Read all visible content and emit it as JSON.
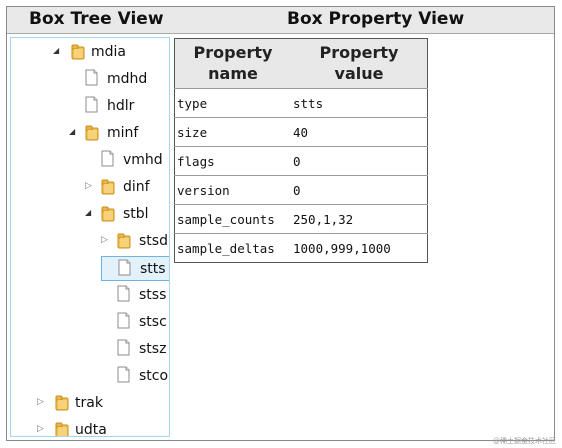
{
  "headers": {
    "tree": "Box Tree View",
    "property": "Box Property View"
  },
  "tree": [
    {
      "label": "mdia",
      "kind": "folder",
      "state": "expanded",
      "selected": false
    },
    {
      "label": "mdhd",
      "kind": "file",
      "state": "leaf",
      "selected": false
    },
    {
      "label": "hdlr",
      "kind": "file",
      "state": "leaf",
      "selected": false
    },
    {
      "label": "minf",
      "kind": "folder",
      "state": "expanded",
      "selected": false
    },
    {
      "label": "vmhd",
      "kind": "file",
      "state": "leaf",
      "selected": false
    },
    {
      "label": "dinf",
      "kind": "folder",
      "state": "collapsed",
      "selected": false
    },
    {
      "label": "stbl",
      "kind": "folder",
      "state": "expanded",
      "selected": false
    },
    {
      "label": "stsd",
      "kind": "folder",
      "state": "collapsed",
      "selected": false
    },
    {
      "label": "stts",
      "kind": "file",
      "state": "leaf",
      "selected": true
    },
    {
      "label": "stss",
      "kind": "file",
      "state": "leaf",
      "selected": false
    },
    {
      "label": "stsc",
      "kind": "file",
      "state": "leaf",
      "selected": false
    },
    {
      "label": "stsz",
      "kind": "file",
      "state": "leaf",
      "selected": false
    },
    {
      "label": "stco",
      "kind": "file",
      "state": "leaf",
      "selected": false
    },
    {
      "label": "trak",
      "kind": "folder",
      "state": "collapsed",
      "selected": false
    },
    {
      "label": "udta",
      "kind": "folder",
      "state": "collapsed",
      "selected": false
    }
  ],
  "table": {
    "col1": "Property name",
    "col2": "Property value",
    "rows": [
      {
        "name": "type",
        "value": "stts"
      },
      {
        "name": "size",
        "value": "40"
      },
      {
        "name": "flags",
        "value": "0"
      },
      {
        "name": "version",
        "value": "0"
      },
      {
        "name": "sample_counts",
        "value": "250,1,32"
      },
      {
        "name": "sample_deltas",
        "value": "1000,999,1000"
      }
    ]
  },
  "watermark": "@稀土掘金技术社区",
  "colors": {
    "selection_bg": "#e3f1fb",
    "selection_border": "#6fb3e0",
    "folder": "#e8b64a"
  }
}
